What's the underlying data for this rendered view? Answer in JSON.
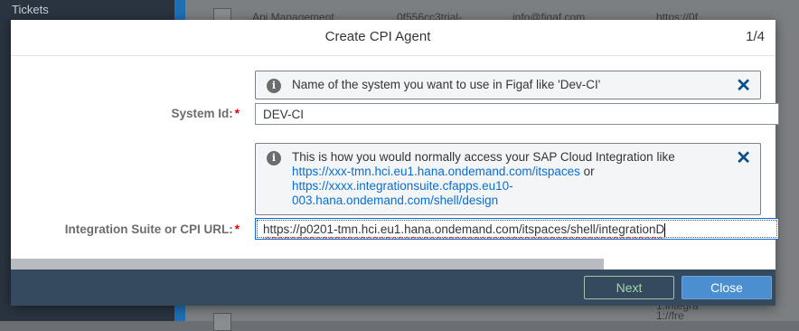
{
  "background": {
    "sidebar_label": "Tickets",
    "row": {
      "name": "Api Management",
      "id": "0f556cc3trial-",
      "email": "info@figaf.com",
      "url": "https://0f"
    },
    "bottom_row": {
      "url_line1": "1.integra",
      "url_line2": "1://fre"
    }
  },
  "dialog": {
    "title": "Create CPI Agent",
    "step": "1/4",
    "system_id_hint": "Name of the system you want to use in Figaf like 'Dev-CI'",
    "system_id_label": "System Id:",
    "system_id_value": "DEV-CI",
    "url_hint_text": "This is how you would normally access your SAP Cloud Integration like",
    "url_hint_link1": "https://xxx-tmn.hci.eu1.hana.ondemand.com/itspaces",
    "url_hint_or": " or",
    "url_hint_link2a": "https://xxxx.integrationsuite.cfapps.eu10-",
    "url_hint_link2b": "003.hana.ondemand.com/shell/design",
    "url_label": "Integration Suite or CPI URL:",
    "url_value": "https://p0201-tmn.hci.eu1.hana.ondemand.com/itspaces/shell/integrationD",
    "required_marker": "*",
    "next_label": "Next",
    "close_label": "Close"
  },
  "icons": {
    "info": "info-icon",
    "close": "close-icon"
  }
}
